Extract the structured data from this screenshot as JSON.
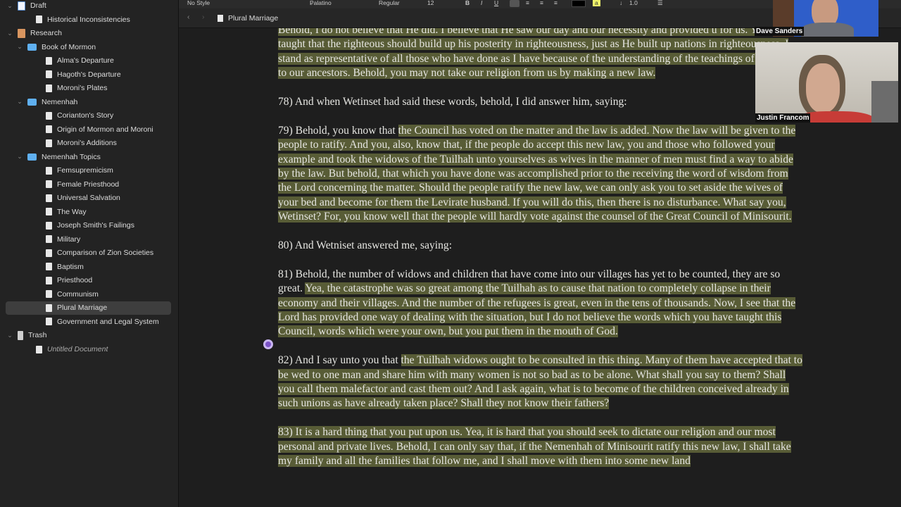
{
  "sidebar": {
    "items": [
      {
        "label": "Draft",
        "type": "draft",
        "level": 0,
        "chev": true
      },
      {
        "label": "Historical Inconsistencies",
        "type": "doc",
        "level": 1
      },
      {
        "label": "Research",
        "type": "research",
        "level": 0,
        "chev": true
      },
      {
        "label": "Book of Mormon",
        "type": "folder",
        "level": 1,
        "chev": true
      },
      {
        "label": "Alma's Departure",
        "type": "doc",
        "level": 2
      },
      {
        "label": "Hagoth's Departure",
        "type": "doc",
        "level": 2
      },
      {
        "label": "Moroni's Plates",
        "type": "doc",
        "level": 2
      },
      {
        "label": "Nemenhah",
        "type": "folder",
        "level": 1,
        "chev": true
      },
      {
        "label": "Corianton's Story",
        "type": "doc",
        "level": 2
      },
      {
        "label": "Origin of Mormon and Moroni",
        "type": "doc",
        "level": 2
      },
      {
        "label": "Moroni's Additions",
        "type": "doc",
        "level": 2
      },
      {
        "label": "Nemenhah Topics",
        "type": "folder",
        "level": 1,
        "chev": true
      },
      {
        "label": "Femsupremicism",
        "type": "doc",
        "level": 2
      },
      {
        "label": "Female Priesthood",
        "type": "doc",
        "level": 2
      },
      {
        "label": "Universal Salvation",
        "type": "doc",
        "level": 2
      },
      {
        "label": "The Way",
        "type": "doc",
        "level": 2
      },
      {
        "label": "Joseph Smith's Failings",
        "type": "doc",
        "level": 2
      },
      {
        "label": "Military",
        "type": "doc",
        "level": 2
      },
      {
        "label": "Comparison of Zion Societies",
        "type": "doc",
        "level": 2
      },
      {
        "label": "Baptism",
        "type": "doc",
        "level": 2
      },
      {
        "label": "Priesthood",
        "type": "doc",
        "level": 2
      },
      {
        "label": "Communism",
        "type": "doc",
        "level": 2
      },
      {
        "label": "Plural Marriage",
        "type": "doc",
        "level": 2,
        "selected": true
      },
      {
        "label": "Government and Legal System",
        "type": "doc",
        "level": 2
      },
      {
        "label": "Trash",
        "type": "trash",
        "level": 0,
        "chev": true
      },
      {
        "label": "Untitled Document",
        "type": "doc",
        "level": 1,
        "italic": true
      }
    ]
  },
  "toolbar": {
    "style": "No Style",
    "font": "Palatino",
    "weight": "Regular",
    "size": "12",
    "bold": "B",
    "italic": "I",
    "underline": "U",
    "highlight": "a",
    "spacing": "1.0"
  },
  "navbar": {
    "back": "‹",
    "forward": "›",
    "doc_title": "Plural Marriage"
  },
  "document": {
    "paragraphs": [
      [
        {
          "t": "Behold, I do not believe that He did. I believe that He saw our day and our necessity and provided u for us. Yea, He taught that the righteous should build up his posterity in righteousness, just as He built up nations in righteousness. I stand as representative of all those who have done as I have because of the understanding of the teachings of the Lord to our ancestors. Behold, you may not take our religion from us by making a new law.",
          "hl": true
        }
      ],
      [
        {
          "t": "78) And when Wetinset had said these words, behold, I did answer him, saying:",
          "hl": false
        }
      ],
      [
        {
          "t": "79) Behold, you know that ",
          "hl": false
        },
        {
          "t": "the Council has voted on the matter and the law is added. Now the law will be given to the people to ratify. And you, also, know that, if the people do accept this new law, you and those who followed your example and took the widows of the Tuilhah unto yourselves as wives in the manner of men must find a way to abide by the law. But behold, that which you have done was accomplished prior to the receiving the word of wisdom from the Lord concerning the matter. Should the people ratify the new law, we can only ask you to set aside the wives of your bed and become for them the Levirate husband. If you will do this, then there is no disturbance. What say you, Wetinset? For, you know well that the people will hardly vote against the counsel of the Great Council of Minisourit.",
          "hl": true
        }
      ],
      [
        {
          "t": "80) And Wetniset answered me, saying:",
          "hl": false
        }
      ],
      [
        {
          "t": "81) Behold, the number of widows and children that have come into our villages has yet to be counted, they are so great. ",
          "hl": false
        },
        {
          "t": "Yea, the catastrophe was so great among the Tuilhah as to cause that nation to completely collapse in their economy and their villages. And the number of the refugees is great, even in the tens of thousands. Now, I see that the Lord has provided one way of dealing with the situation, but I do not believe the words which you have taught this Council, words which were your own, but you put them in the mouth of God.",
          "hl": true
        }
      ],
      [
        {
          "t": "82) And I say unto you that ",
          "hl": false
        },
        {
          "t": "the Tuilhah widows ought to be consulted in this thing. Many of them have accepted that to be wed to one man and share him with many women is not so bad as to be alone. What shall you say to them? Shall you call them malefactor and cast them out? And I ask again, what is to become of the children conceived already in such unions as have already taken place? Shall they not know their fathers?",
          "hl": true
        }
      ],
      [
        {
          "t": "83) It is a hard thing that you put upon us. Yea, it is hard that you should seek to dictate our religion and our most personal and private lives. Behold, I can only say that, if the Nemenhah of Minisourit ratify this new law, I shall take my family and all the families that follow me, and I shall move with them into some new land",
          "hl": true
        }
      ]
    ]
  },
  "video": {
    "participants": [
      "Dave Sanders",
      "Justin Francom"
    ]
  },
  "colors": {
    "highlight": "#585c36",
    "sidebar_bg": "#232323",
    "editor_bg": "#1e1e1e"
  }
}
